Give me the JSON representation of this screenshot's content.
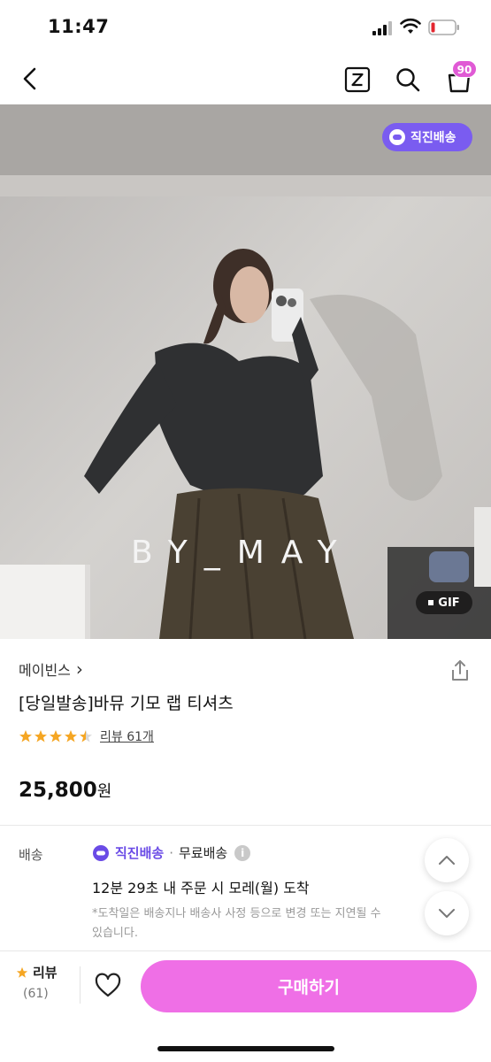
{
  "status_bar": {
    "time": "11:47"
  },
  "header": {
    "cart_count": "90"
  },
  "hero": {
    "direct_badge": "직진배송",
    "watermark": "BY_MAY",
    "gif_label": "GIF"
  },
  "product": {
    "brand": "메이빈스",
    "brand_chevron": "›",
    "title": "[당일발송]바뮤 기모 랩 티셔츠",
    "rating": 4.5,
    "review_link": "리뷰 61개",
    "price_number": "25,800",
    "price_unit": "원"
  },
  "shipping": {
    "label": "배송",
    "brand": "직진배송",
    "dot": "·",
    "type": "무료배송",
    "info_mark": "i",
    "eta": "12분 29초 내 주문 시 모레(월) 도착",
    "note": "*도착일은 배송지나 배송사 사정 등으로 변경 또는 지연될 수 있습니다."
  },
  "bottom_bar": {
    "review_label": "리뷰",
    "review_count": "(61)",
    "buy_label": "구매하기"
  },
  "colors": {
    "accent_purple": "#7a5cf0",
    "buy_pink": "#ef6fe6",
    "badge_pink": "#e05ad5",
    "star_orange": "#f5a623"
  }
}
